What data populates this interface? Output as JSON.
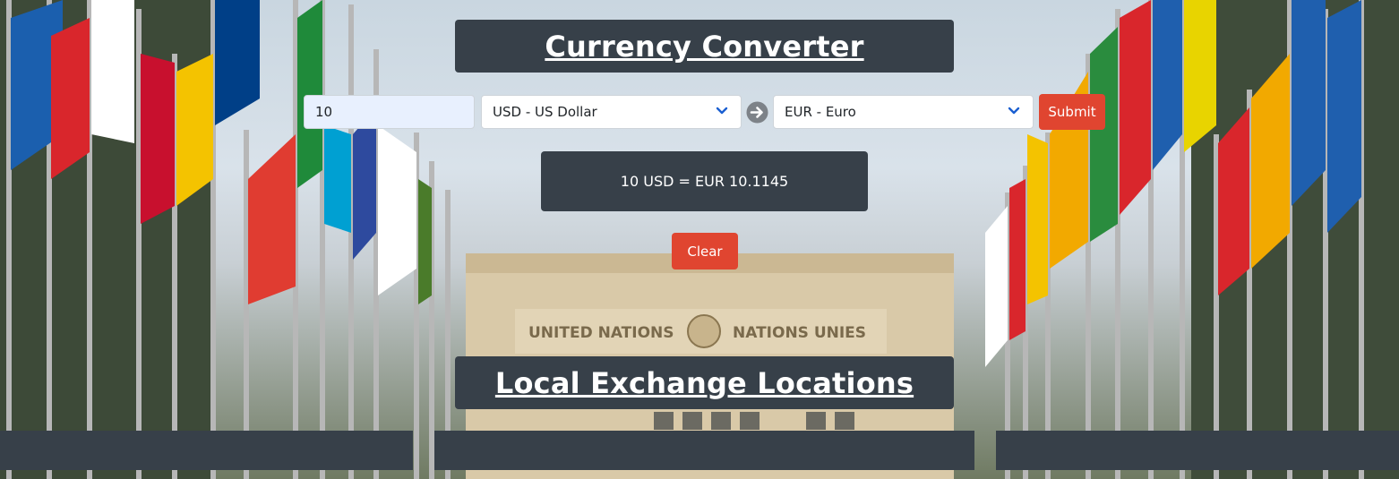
{
  "converter": {
    "title": "Currency Converter",
    "amount": "10",
    "from_currency": "USD - US Dollar",
    "to_currency": "EUR - Euro",
    "submit_label": "Submit",
    "result_text": "10 USD = EUR 10.1145",
    "clear_label": "Clear"
  },
  "locations": {
    "title": "Local Exchange Locations"
  },
  "background": {
    "building_sign": "UNITED NATIONS",
    "building_sign_fr": "NATIONS UNIES"
  },
  "icons": {
    "swap": "arrow-right-circle-icon",
    "dropdown": "chevron-down-icon",
    "emblem": "un-emblem-icon"
  },
  "colors": {
    "panel": "#374049",
    "button": "#e04530",
    "input_bg": "#e8f0fe",
    "chevron": "#1a5fd1"
  }
}
